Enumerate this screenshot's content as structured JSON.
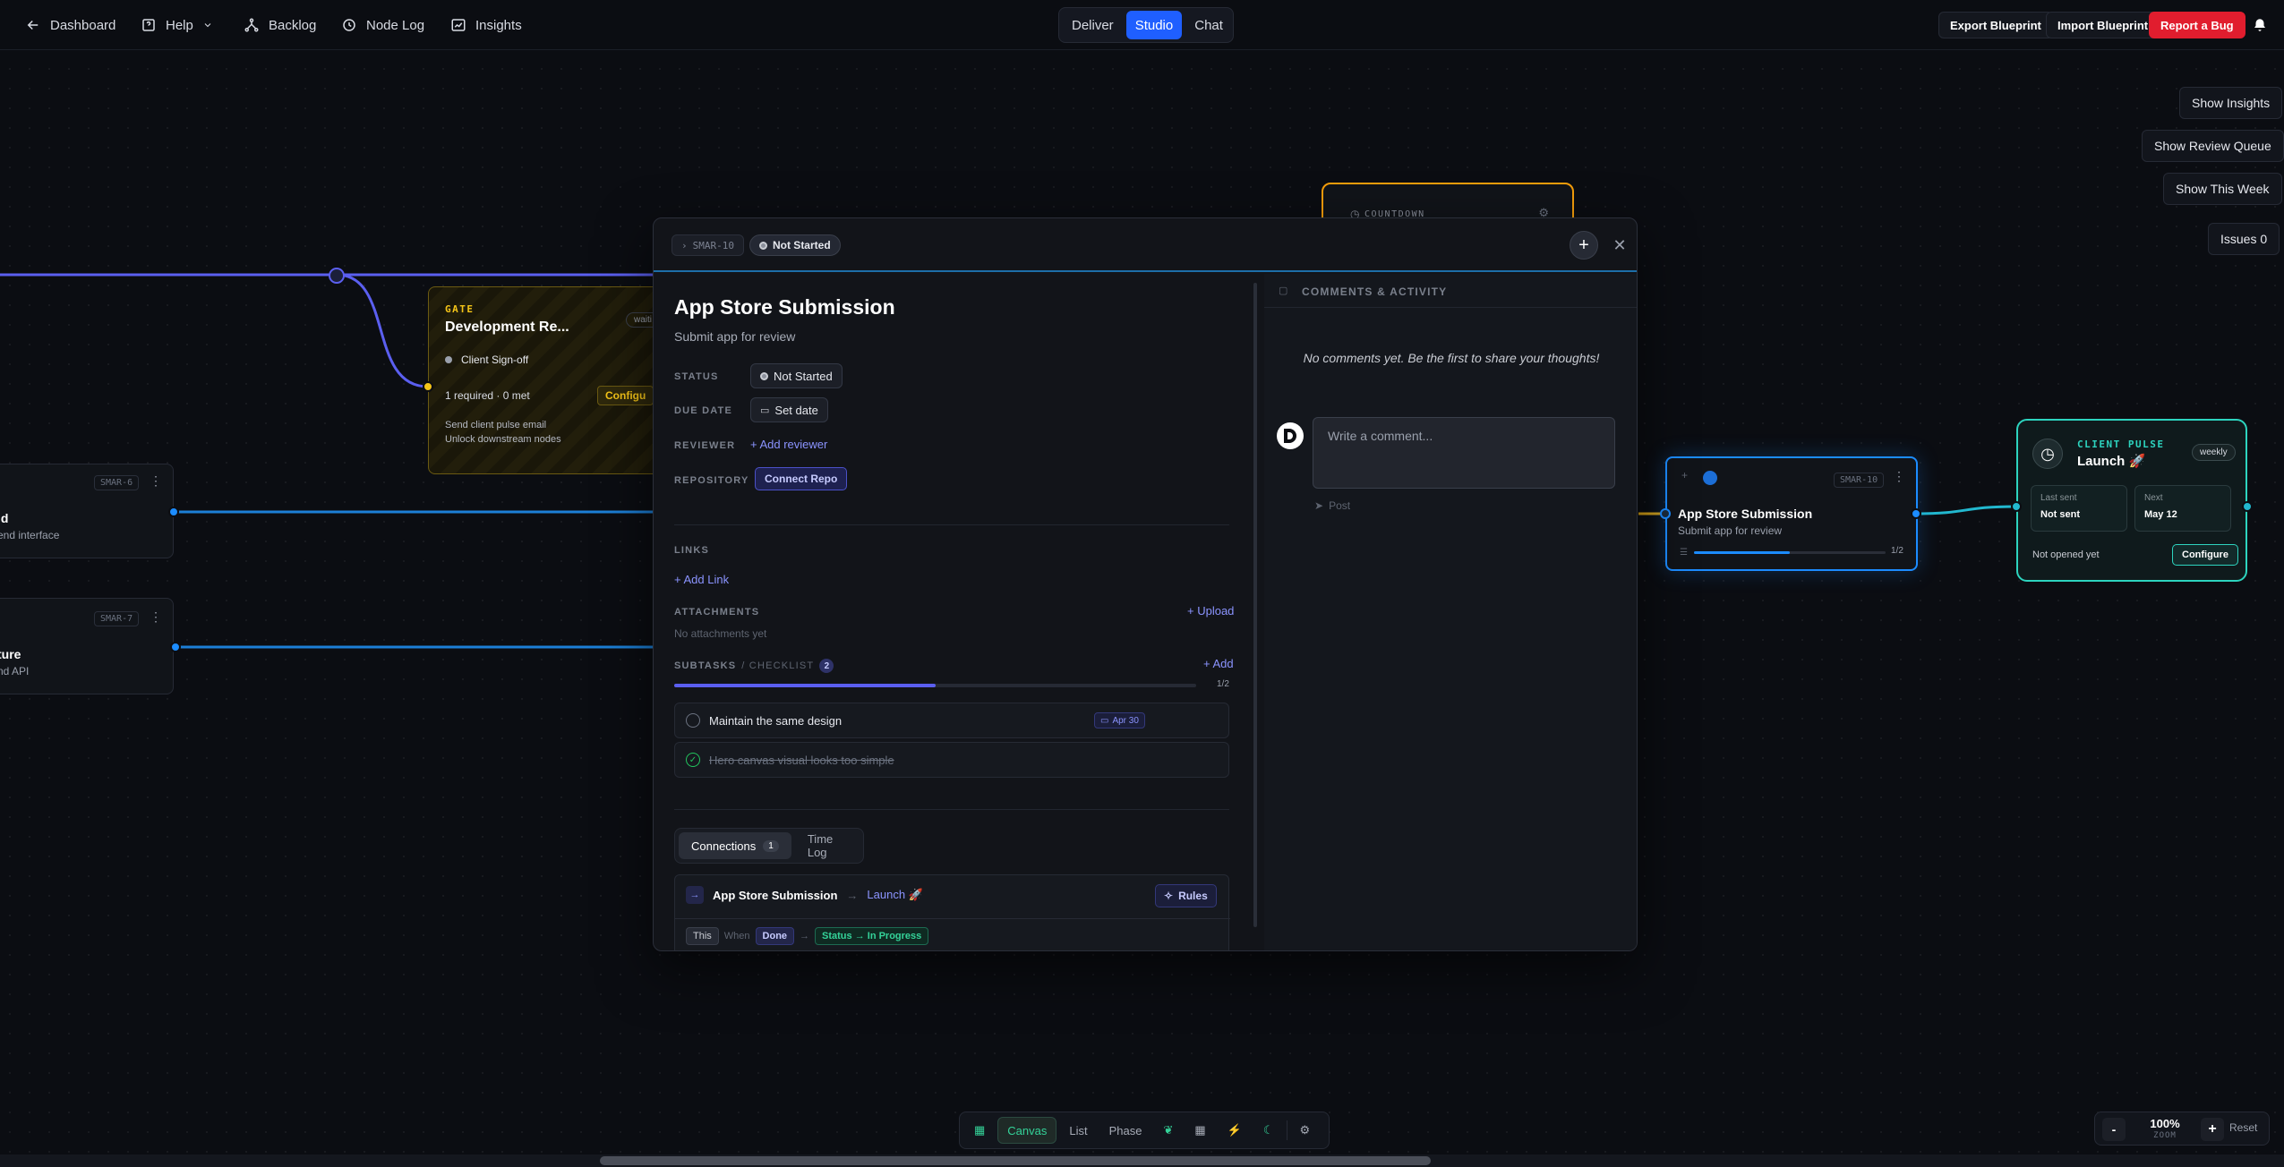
{
  "topbar": {
    "back_label": "Dashboard",
    "help_label": "Help",
    "backlog_label": "Backlog",
    "node_log_label": "Node Log",
    "insights_label": "Insights",
    "modes": [
      "Deliver",
      "Studio",
      "Chat"
    ],
    "active_mode": "Studio",
    "export_label": "Export Blueprint",
    "import_label": "Import Blueprint",
    "report_label": "Report a Bug"
  },
  "side_panel": {
    "show_insights": "Show Insights",
    "show_review_queue": "Show Review Queue",
    "show_this_week": "Show This Week",
    "issues": "Issues 0"
  },
  "canvas": {
    "countdown_label": "COUNTDOWN",
    "gate": {
      "kind": "GATE",
      "title": "Development Re...",
      "badge": "waiti",
      "item": "Client Sign-off",
      "requirement": "1 required · 0 met",
      "configure": "Configu",
      "line1": "Send client pulse email",
      "line2": "Unlock downstream nodes"
    },
    "node_a": {
      "tag": "SMAR-6",
      "title": "ld",
      "sub": "end interface"
    },
    "node_b": {
      "tag": "SMAR-7",
      "title": "ture",
      "sub": "nd API"
    },
    "app_node": {
      "tag": "SMAR-10",
      "title": "App Store Submission",
      "sub": "Submit app for review",
      "progress_text": "1/2",
      "progress": 0.5
    },
    "pulse": {
      "kind": "CLIENT PULSE",
      "title": "Launch 🚀",
      "badge": "weekly",
      "last_sent_label": "Last sent",
      "last_sent_value": "Not sent",
      "next_label": "Next",
      "next_value": "May 12",
      "status": "Not opened yet",
      "configure": "Configure"
    }
  },
  "modal": {
    "id": "SMAR-10",
    "status_chip": "Not Started",
    "title": "App Store Submission",
    "subtitle": "Submit app for review",
    "fields": {
      "status_label": "STATUS",
      "status_value": "Not Started",
      "due_label": "DUE DATE",
      "due_value": "Set date",
      "reviewer_label": "REVIEWER",
      "reviewer_action": "+ Add reviewer",
      "repo_label": "REPOSITORY",
      "repo_action": "Connect Repo"
    },
    "links_label": "LINKS",
    "add_link": "+ Add Link",
    "attachments_label": "ATTACHMENTS",
    "upload": "+ Upload",
    "no_attachments": "No attachments yet",
    "subtasks_label": "SUBTASKS",
    "checklist_label": "/ CHECKLIST",
    "subtasks_count": "2",
    "add_subtask": "+ Add",
    "subtasks_progress_text": "1/2",
    "subtasks_progress": 0.5,
    "subtasks": [
      {
        "text": "Maintain the same design",
        "date": "Apr 30",
        "done": false
      },
      {
        "text": "Hero canvas visual looks too simple",
        "date": "",
        "done": true
      }
    ],
    "tabs": {
      "connections": "Connections",
      "connections_count": "1",
      "time_log": "Time Log"
    },
    "connection": {
      "from": "App Store Submission",
      "arrow": "→",
      "to": "Launch 🚀",
      "rules": "Rules",
      "this": "This",
      "when": "When",
      "done": "Done",
      "result": "Status → In Progress"
    },
    "comments": {
      "header": "COMMENTS & ACTIVITY",
      "empty": "No comments yet. Be the first to share your thoughts!",
      "placeholder": "Write a comment...",
      "post": "Post"
    }
  },
  "bottom_bar": {
    "canvas": "Canvas",
    "list": "List",
    "phase": "Phase"
  },
  "zoom": {
    "minus": "-",
    "value": "100%",
    "label": "ZOOM",
    "plus": "+",
    "reset": "Reset"
  },
  "colors": {
    "accent": "#1f5fff",
    "danger": "#e11d2e",
    "gate": "#f5c518",
    "countdown": "#f59e0b",
    "pulse": "#2dd4bf",
    "link": "#8b94ff"
  }
}
